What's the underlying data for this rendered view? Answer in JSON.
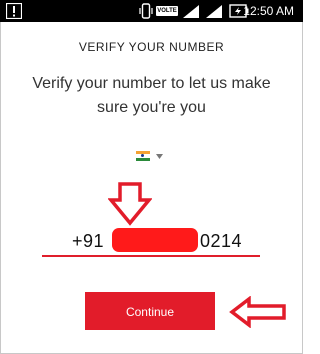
{
  "status_bar": {
    "volte_label": "VOLTE",
    "time": "12:50 AM",
    "icons": [
      "alert-icon",
      "vibrate-icon",
      "volte-icon",
      "signal-icon",
      "signal-icon",
      "battery-icon"
    ]
  },
  "verify": {
    "title": "VERIFY YOUR NUMBER",
    "subtitle": "Verify your number to let us make sure you're you",
    "country_icon": "india-flag-icon",
    "phone_prefix": "+91",
    "phone_suffix": "0214",
    "continue_label": "Continue"
  },
  "annotations": {
    "arrow_color": "#e21c2a",
    "arrows": [
      "arrow-down-icon",
      "arrow-left-icon"
    ]
  },
  "colors": {
    "accent": "#e21c2a",
    "status_bar": "#000000"
  }
}
